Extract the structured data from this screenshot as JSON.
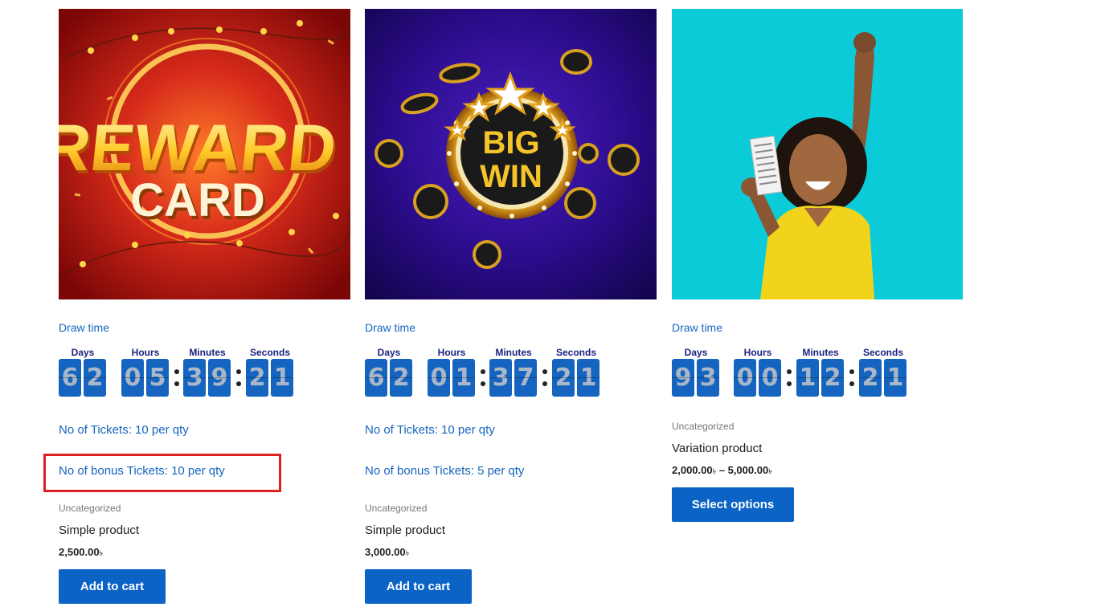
{
  "products": [
    {
      "image_alt": "REWARD CARD",
      "image_text_top": "REWARD",
      "image_text_bottom": "CARD",
      "draw_time_label": "Draw time",
      "countdown_labels": [
        "Days",
        "Hours",
        "Minutes",
        "Seconds"
      ],
      "countdown_digits": [
        "6",
        "2",
        "0",
        "5",
        "3",
        "9",
        "2",
        "1"
      ],
      "tickets": "No of Tickets: 10 per qty",
      "bonus_tickets": "No of bonus Tickets: 10 per qty",
      "category": "Uncategorized",
      "title": "Simple product",
      "price": "2,500.00",
      "currency": "৳",
      "button_label": "Add to cart"
    },
    {
      "image_alt": "BIG WIN",
      "image_text_top": "BIG",
      "image_text_bottom": "WIN",
      "draw_time_label": "Draw time",
      "countdown_labels": [
        "Days",
        "Hours",
        "Minutes",
        "Seconds"
      ],
      "countdown_digits": [
        "6",
        "2",
        "0",
        "1",
        "3",
        "7",
        "2",
        "1"
      ],
      "tickets": "No of Tickets: 10 per qty",
      "bonus_tickets": "No of bonus Tickets: 5 per qty",
      "category": "Uncategorized",
      "title": "Simple product",
      "price": "3,000.00",
      "currency": "৳",
      "button_label": "Add to cart"
    },
    {
      "draw_time_label": "Draw time",
      "countdown_labels": [
        "Days",
        "Hours",
        "Minutes",
        "Seconds"
      ],
      "countdown_digits": [
        "9",
        "3",
        "0",
        "0",
        "1",
        "2",
        "2",
        "1"
      ],
      "category": "Uncategorized",
      "title": "Variation product",
      "price_min": "2,000.00",
      "price_max": "5,000.00",
      "price_separator": "–",
      "currency": "৳",
      "button_label": "Select options"
    }
  ],
  "colors": {
    "link": "#1565c0",
    "button": "#0b63c5",
    "digit_bg": "#1565c0",
    "highlight": "#e02020"
  }
}
